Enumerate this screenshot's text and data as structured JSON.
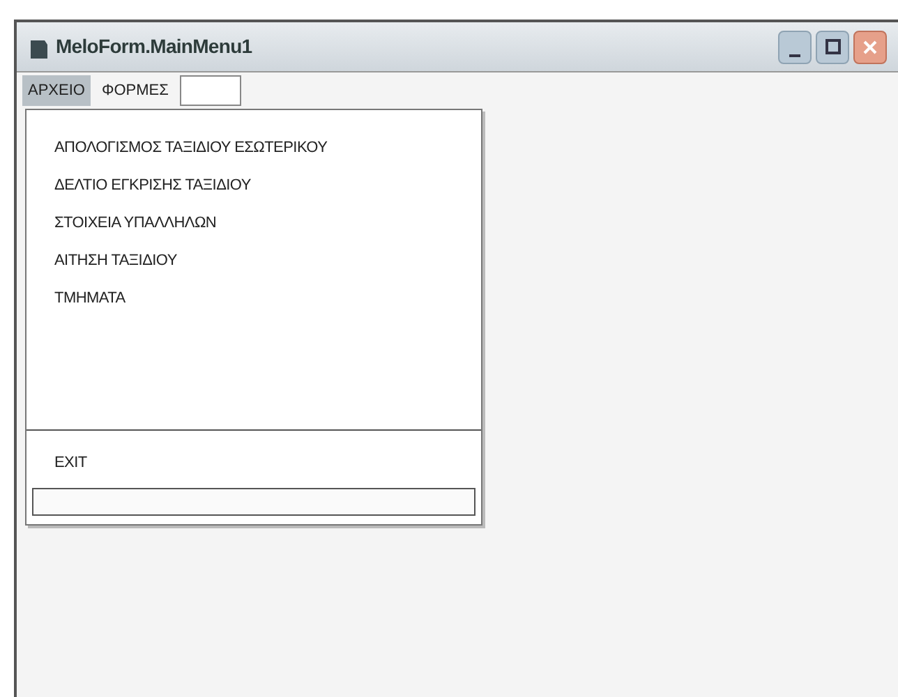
{
  "window": {
    "title": "MeloForm.MainMenu1"
  },
  "menu_bar": [
    {
      "label": "ΑΡΧΕΙΟ",
      "selected": true
    },
    {
      "label": "ΦΟΡΜΕΣ",
      "selected": false
    },
    {
      "kind": "box",
      "selected": false
    }
  ],
  "dropdown": [
    {
      "kind": "item",
      "label": "ΑΠΟΛΟΓΙΣΜΟΣ ΤΑΞΙΔΙΟΥ ΕΣΩΤΕΡΙΚΟΥ"
    },
    {
      "kind": "item",
      "label": "ΔΕΛΤΙΟ ΕΓΚΡΙΣΗΣ ΤΑΞΙΔΙΟΥ"
    },
    {
      "kind": "item",
      "label": "ΣΤΟΙΧΕΙΑ ΥΠΑΛΛΗΛΩΝ"
    },
    {
      "kind": "item",
      "label": "ΑΙΤΗΣΗ ΤΑΞΙΔΙΟΥ"
    },
    {
      "kind": "item",
      "label": "ΤΜΗΜΑΤΑ"
    },
    {
      "kind": "separator"
    },
    {
      "kind": "item",
      "label": "EXIT"
    },
    {
      "kind": "box"
    }
  ]
}
